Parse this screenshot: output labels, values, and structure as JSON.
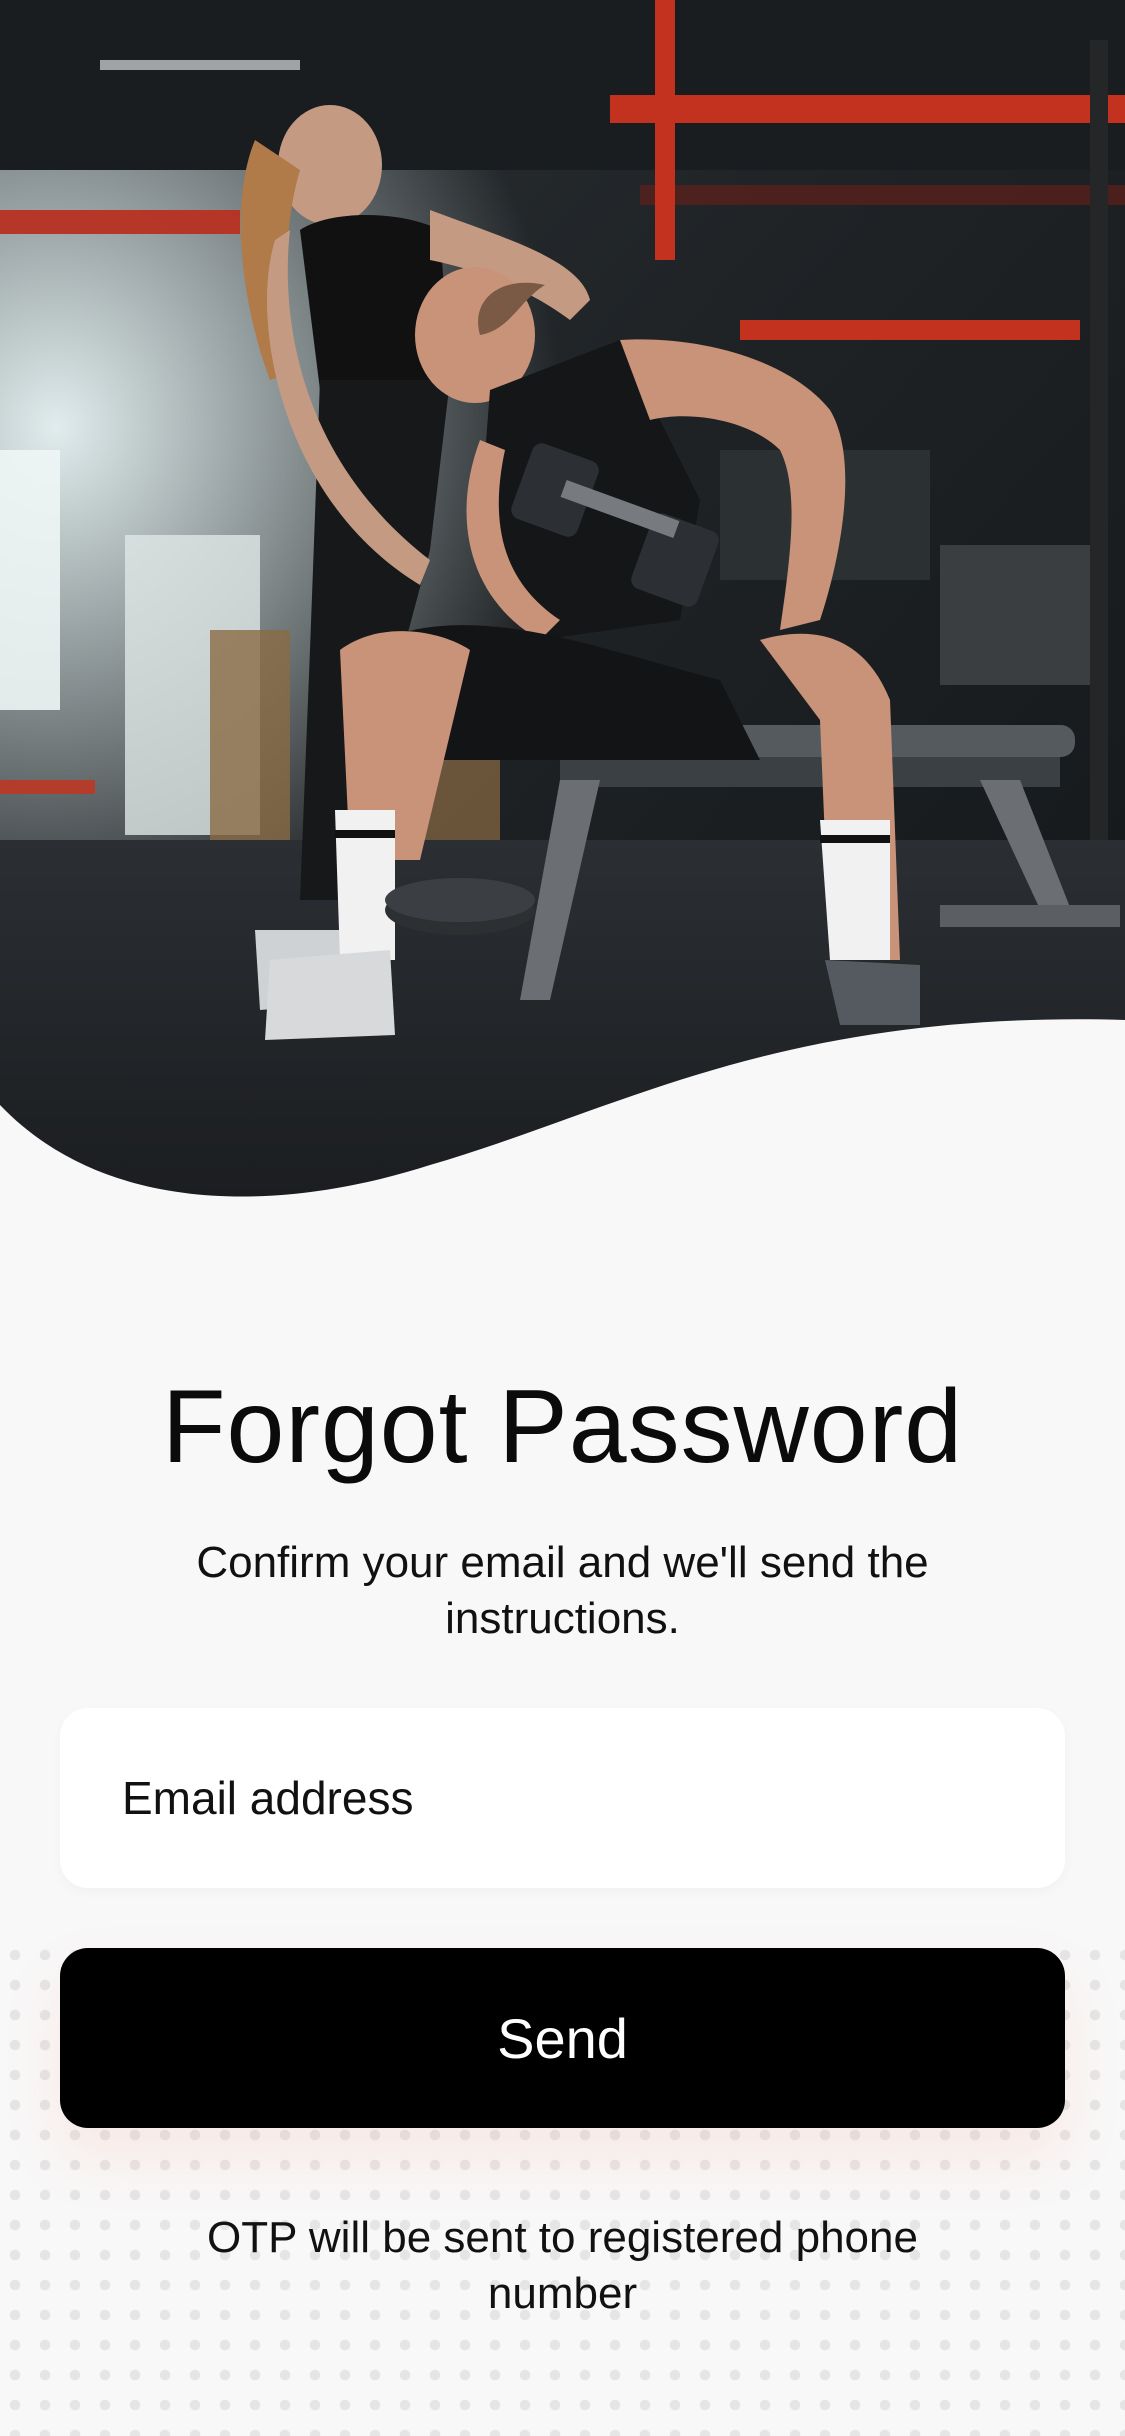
{
  "hero": {
    "image_label": "gym-photo"
  },
  "screen": {
    "title": "Forgot Password",
    "subtitle": "Confirm your email and we'll send the instructions.",
    "email_placeholder": "Email address",
    "send_label": "Send",
    "otp_note": "OTP will be sent to registered phone number"
  },
  "colors": {
    "background": "#f8f8f8",
    "button": "#000000",
    "button_text": "#ffffff",
    "field_background": "#ffffff"
  },
  "icons": {
    "hero": "gym-photo-illustration"
  }
}
